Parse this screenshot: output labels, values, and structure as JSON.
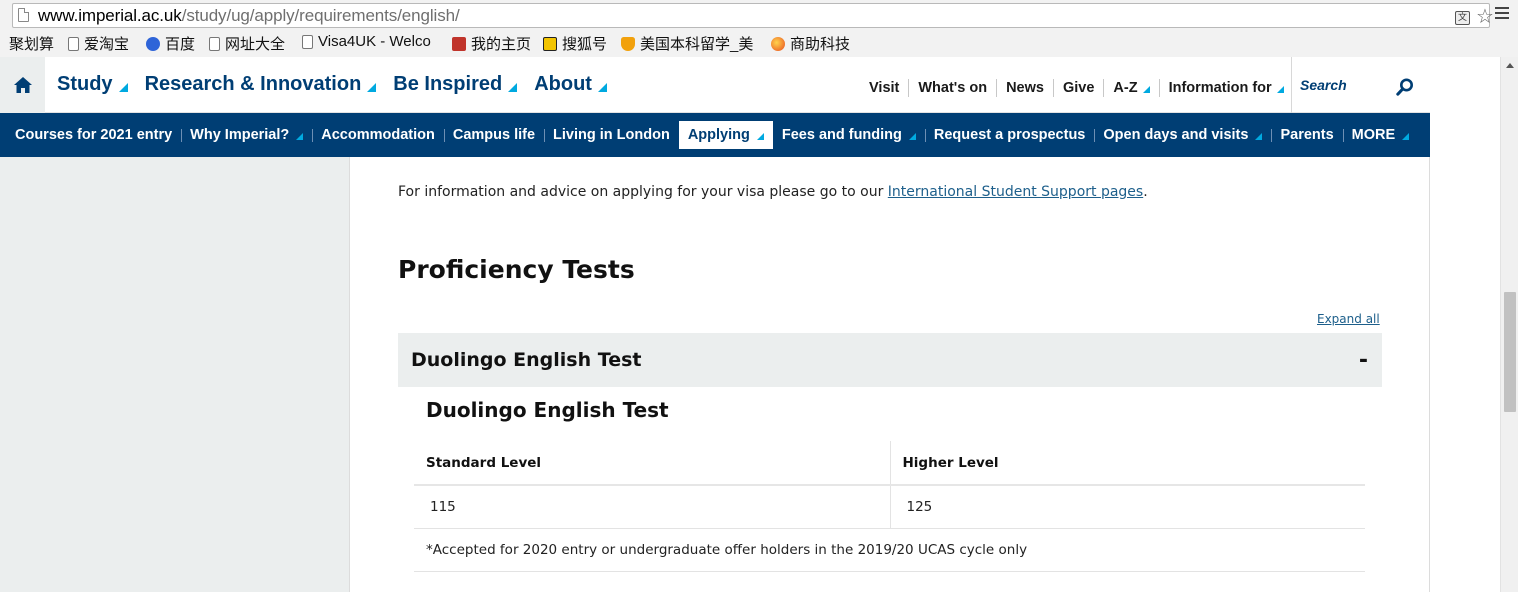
{
  "browser": {
    "url_host": "www.imperial.ac.uk",
    "url_path": "/study/ug/apply/requirements/english/",
    "translate_icon": "translate-icon",
    "star_icon": "bookmark-star-icon",
    "menu_icon": "hamburger-menu-icon",
    "bookmarks": [
      {
        "label": "聚划算",
        "icon": "none"
      },
      {
        "label": "爱淘宝",
        "icon": "page-icon"
      },
      {
        "label": "百度",
        "icon": "baidu-icon"
      },
      {
        "label": "网址大全",
        "icon": "page-icon"
      },
      {
        "label": "Visa4UK - Welco",
        "icon": "page-icon"
      },
      {
        "label": "我的主页",
        "icon": "shield-icon"
      },
      {
        "label": "搜狐号",
        "icon": "sohu-icon"
      },
      {
        "label": "美国本科留学_美",
        "icon": "y-icon"
      },
      {
        "label": "商助科技",
        "icon": "ball-icon"
      }
    ]
  },
  "header": {
    "main_nav": [
      {
        "label": "Study",
        "has_dropdown": true
      },
      {
        "label": "Research & Innovation",
        "has_dropdown": true
      },
      {
        "label": "Be Inspired",
        "has_dropdown": true
      },
      {
        "label": "About",
        "has_dropdown": true
      }
    ],
    "util_nav": [
      {
        "label": "Visit",
        "has_dropdown": false
      },
      {
        "label": "What's on",
        "has_dropdown": false
      },
      {
        "label": "News",
        "has_dropdown": false
      },
      {
        "label": "Give",
        "has_dropdown": false
      },
      {
        "label": "A-Z",
        "has_dropdown": true
      },
      {
        "label": "Information for",
        "has_dropdown": true
      }
    ],
    "search_placeholder": "Search"
  },
  "sub_nav": [
    {
      "label": "Courses for 2021 entry",
      "has_dropdown": false,
      "active": false
    },
    {
      "label": "Why Imperial?",
      "has_dropdown": true,
      "active": false
    },
    {
      "label": "Accommodation",
      "has_dropdown": false,
      "active": false
    },
    {
      "label": "Campus life",
      "has_dropdown": false,
      "active": false
    },
    {
      "label": "Living in London",
      "has_dropdown": false,
      "active": false
    },
    {
      "label": "Applying",
      "has_dropdown": true,
      "active": true
    },
    {
      "label": "Fees and funding",
      "has_dropdown": true,
      "active": false
    },
    {
      "label": "Request a prospectus",
      "has_dropdown": false,
      "active": false
    },
    {
      "label": "Open days and visits",
      "has_dropdown": true,
      "active": false
    },
    {
      "label": "Parents",
      "has_dropdown": false,
      "active": false
    },
    {
      "label": "MORE",
      "has_dropdown": true,
      "active": false
    }
  ],
  "content": {
    "info_prefix": "For information and advice on applying for your visa please go to our ",
    "info_link": "International Student Support pages",
    "info_suffix": ".",
    "heading": "Proficiency Tests",
    "expand_all": "Expand all",
    "accordion": {
      "title": "Duolingo English Test",
      "toggle": "-",
      "subtitle": "Duolingo English Test",
      "table": {
        "headers": [
          "Standard Level",
          "Higher Level"
        ],
        "row": [
          "115",
          "125"
        ],
        "note": "*Accepted for 2020 entry or undergraduate offer holders in the 2019/20 UCAS cycle only"
      }
    }
  },
  "colors": {
    "brand_navy": "#003e74",
    "accent_blue": "#00a9e0",
    "panel_grey": "#ebeeee",
    "link": "#1d5f8b"
  }
}
